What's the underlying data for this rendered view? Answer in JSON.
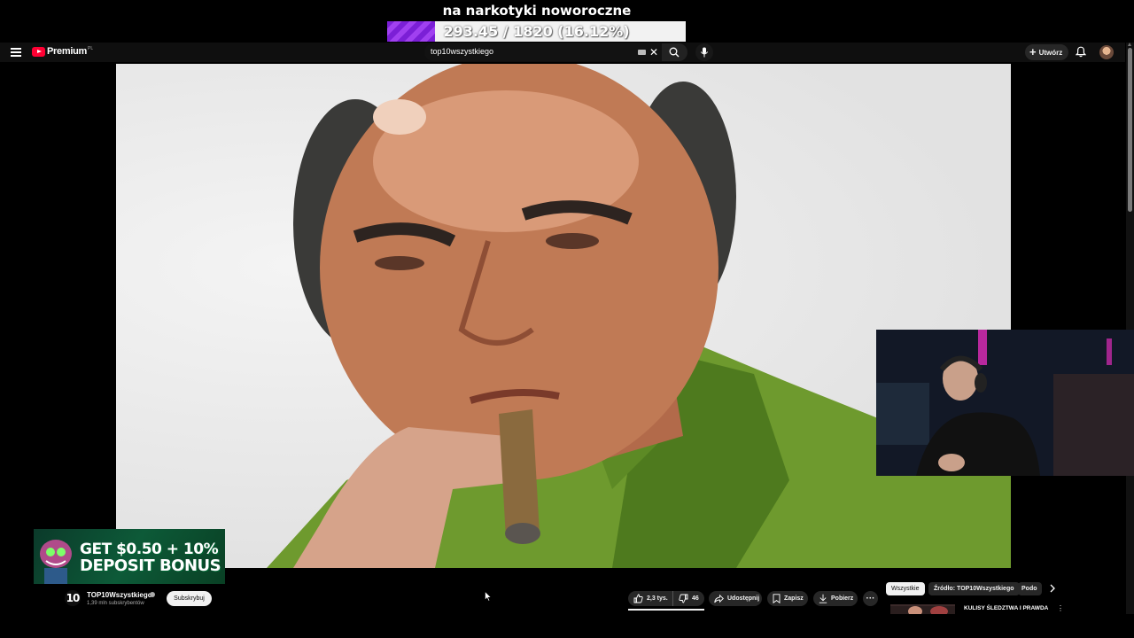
{
  "stream_goal": {
    "title": "na narkotyki noworoczne",
    "progress_text": "293.45 / 1820 (16.12%)",
    "progress_fraction": 0.1612
  },
  "header": {
    "logo_text": "Premium",
    "region_code": "PL",
    "search_value": "top10wszystkiego",
    "create_label": "Utwórz"
  },
  "ad": {
    "line1": "GET $0.50 + 10%",
    "line2": "DEPOSIT BONUS"
  },
  "channel": {
    "logo_text": "10",
    "name": "TOP10Wszystkiego",
    "subscribers": "1,39 mln subskrybentów",
    "subscribe_label": "Subskrybuj"
  },
  "actions": {
    "likes": "2,3 tys.",
    "dislikes": "46",
    "share": "Udostępnij",
    "save": "Zapisz",
    "download": "Pobierz"
  },
  "chips": [
    "Wszystkie",
    "Źródło: TOP10Wszystkiego",
    "Podo"
  ],
  "recommendation": {
    "title": "KULISY ŚLEDZTWA I PRAWDA"
  },
  "colors": {
    "goal_fill": "#8a2be2",
    "yt_red": "#ff0033",
    "shirt_green": "#6e9a2e"
  }
}
